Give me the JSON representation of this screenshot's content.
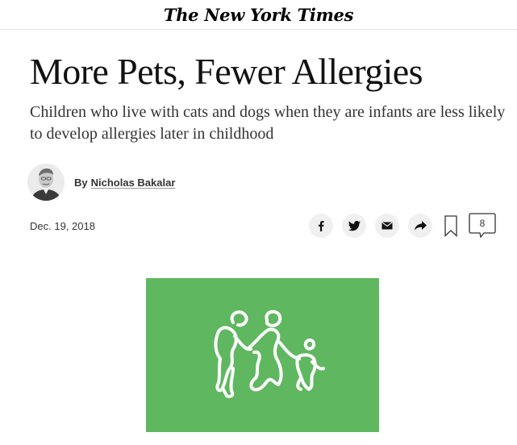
{
  "masthead": {
    "logo_text": "The New York Times"
  },
  "article": {
    "headline": "More Pets, Fewer Allergies",
    "summary": "Children who live with cats and dogs when they are infants are less likely to develop allergies later in childhood",
    "byline": {
      "prefix": "By",
      "author": "Nicholas Bakalar"
    },
    "date": "Dec. 19, 2018"
  },
  "share_tools": {
    "facebook_icon": "facebook-icon",
    "twitter_icon": "twitter-icon",
    "email_icon": "email-icon",
    "share_icon": "share-arrow-icon",
    "save_icon": "bookmark-icon",
    "comments_count": "8"
  },
  "figure": {
    "background_color": "#5fb860",
    "illustration": "family-outline-illustration"
  }
}
